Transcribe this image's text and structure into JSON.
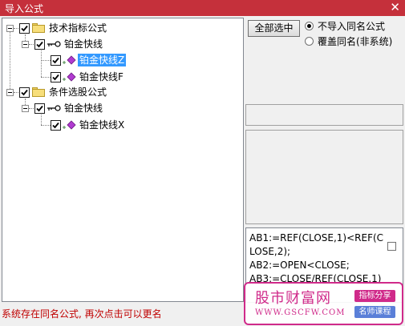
{
  "window": {
    "title": "导入公式",
    "close_glyph": "✕"
  },
  "tree": {
    "nodes": [
      {
        "label": "技术指标公式",
        "checked": true,
        "icon": "folder-icon"
      },
      {
        "label": "铂金快线",
        "checked": true,
        "icon": "key-icon"
      },
      {
        "label": "铂金快线Z",
        "checked": true,
        "icon": "diamond-icon",
        "selected": true
      },
      {
        "label": "铂金快线F",
        "checked": true,
        "icon": "diamond-icon"
      },
      {
        "label": "条件选股公式",
        "checked": true,
        "icon": "folder-icon"
      },
      {
        "label": "铂金快线",
        "checked": true,
        "icon": "key-icon"
      },
      {
        "label": "铂金快线X",
        "checked": true,
        "icon": "diamond-icon"
      }
    ]
  },
  "controls": {
    "select_all_label": "全部选中",
    "radio_no_import": "不导入同名公式",
    "radio_overwrite": "覆盖同名(非系统)",
    "selected_radio": "no_import"
  },
  "code": {
    "lines": [
      "AB1:=REF(CLOSE,1)<REF(CLOSE,2);",
      "AB2:=OPEN<CLOSE;",
      "AB3:=CLOSE/REF(CLOSE,1)"
    ]
  },
  "status": {
    "message": "系统存在同名公式, 再次点击可以更名"
  },
  "watermark": {
    "site": "股市财富网",
    "url": "WWW.GSCFW.COM",
    "tag1": "指标分享",
    "tag2": "名师课程"
  },
  "colors": {
    "titlebar": "#c5303b",
    "selection": "#3399ff",
    "status": "#c00000",
    "watermark": "#d02a8a"
  }
}
